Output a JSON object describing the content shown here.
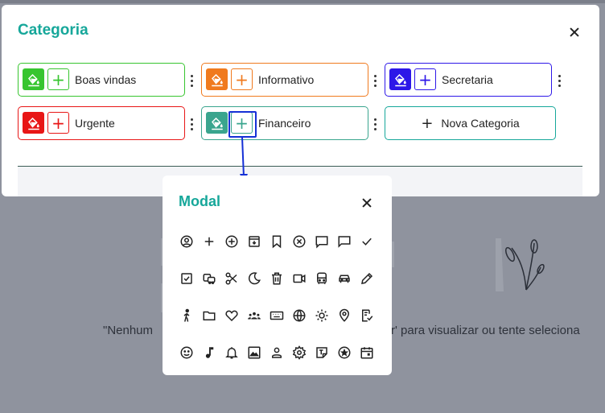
{
  "background": {
    "empty_left": "\"Nenhum",
    "empty_right": "r' para visualizar ou tente seleciona"
  },
  "categoria_modal": {
    "title": "Categoria",
    "categories": [
      {
        "name": "Boas vindas",
        "color": "#37c52f"
      },
      {
        "name": "Informativo",
        "color": "#f07a1e"
      },
      {
        "name": "Secretaria",
        "color": "#2d17e8"
      },
      {
        "name": "Urgente",
        "color": "#e81616"
      },
      {
        "name": "Financeiro",
        "color": "#3aa58e"
      }
    ],
    "nova_label": "Nova Categoria"
  },
  "icon_modal": {
    "title": "Modal",
    "icons": [
      "account-circle-icon",
      "plus-icon",
      "plus-circle-icon",
      "archive-icon",
      "bookmark-icon",
      "close-circle-icon",
      "comment-icon",
      "chat-icon",
      "check-icon",
      "checkbox-icon",
      "bus-car-icon",
      "scissors-icon",
      "moon-icon",
      "trash-icon",
      "video-icon",
      "bus-icon",
      "car-icon",
      "pencil-icon",
      "walk-icon",
      "folder-icon",
      "heart-icon",
      "group-icon",
      "keyboard-icon",
      "globe-icon",
      "sun-icon",
      "map-pin-icon",
      "document-check-icon",
      "smile-icon",
      "music-note-icon",
      "bell-icon",
      "image-icon",
      "user-icon",
      "settings-icon",
      "text-box-icon",
      "star-circle-icon",
      "calendar-icon"
    ]
  },
  "colors": {
    "accent": "#16a79a",
    "highlight": "#1530d6"
  }
}
